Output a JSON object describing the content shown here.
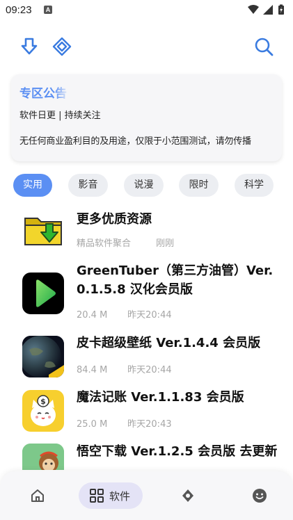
{
  "status_bar": {
    "time": "09:23",
    "notification_badge": "A",
    "icons": [
      "wifi-icon",
      "signal-icon",
      "battery-icon"
    ]
  },
  "toolbar": {
    "icons": [
      "download-icon",
      "diamond-grid-icon",
      "search-icon"
    ],
    "accent_color": "#3a7be0"
  },
  "notice": {
    "title": "专区公告",
    "subtitle": "软件日更 | 持续关注",
    "description": "无任何商业盈利目的及用途，仅限于小范围测试，请勿传播"
  },
  "categories": {
    "items": [
      "实用",
      "影音",
      "说漫",
      "限时",
      "科学"
    ],
    "active_index": 0,
    "active_color": "#5b8ff3"
  },
  "apps": [
    {
      "name": "更多优质资源",
      "size": "精品软件聚合",
      "time": "刚刚",
      "icon": "folder-download-icon"
    },
    {
      "name": "GreenTuber（第三方油管）Ver. 0.1.5.8 汉化会员版",
      "size": "20.4 M",
      "time": "昨天20:44",
      "icon": "green-play-icon"
    },
    {
      "name": "皮卡超级壁纸 Ver.1.4.4 会员版",
      "size": "84.4 M",
      "time": "昨天20:44",
      "icon": "earth-wallpaper-icon"
    },
    {
      "name": "魔法记账 Ver.1.1.83 会员版",
      "size": "25.0 M",
      "time": "昨天20:43",
      "icon": "lucky-cat-icon"
    },
    {
      "name": "悟空下载 Ver.1.2.5 会员版 去更新",
      "size": "",
      "time": "",
      "icon": "monkey-icon"
    }
  ],
  "bottom_nav": {
    "items": [
      "home-icon",
      "software-grid-icon",
      "compass-icon",
      "smiley-icon"
    ],
    "active_label": "软件"
  }
}
